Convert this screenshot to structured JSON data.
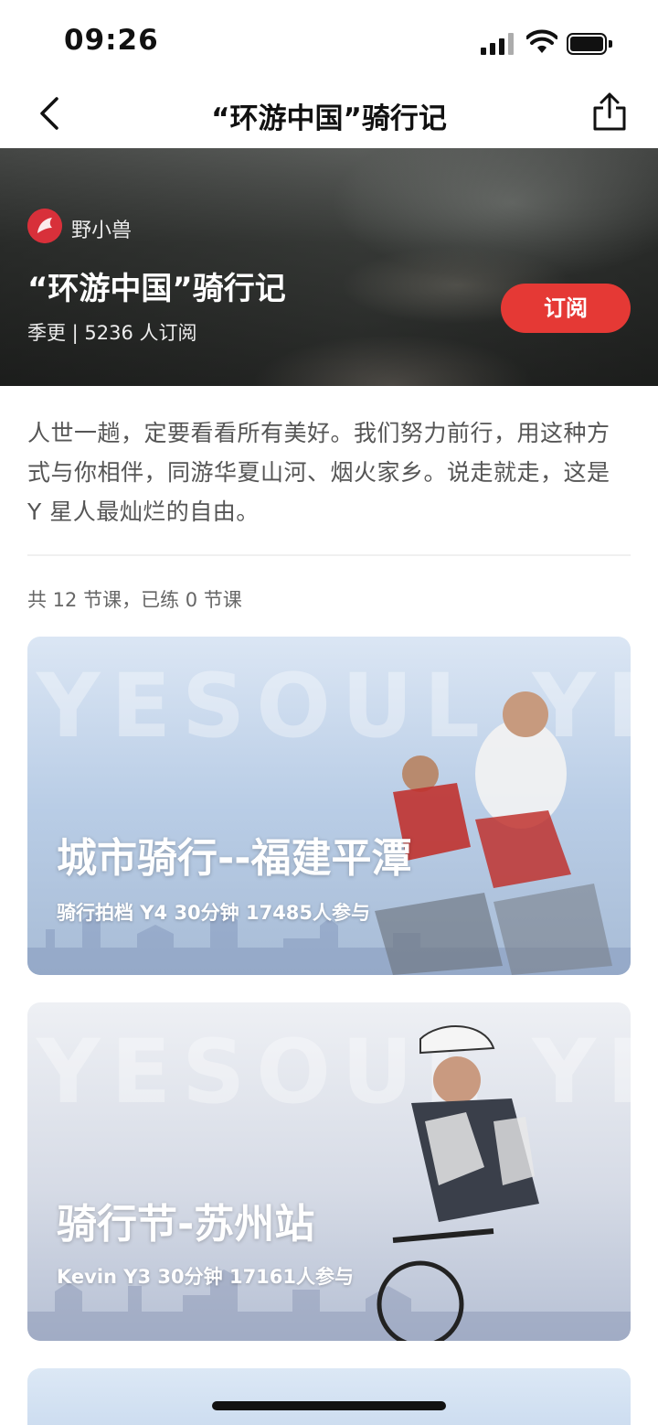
{
  "status_bar": {
    "time": "09:26"
  },
  "nav": {
    "title": "“环游中国”骑行记",
    "back_icon": "chevron-left-icon",
    "share_icon": "share-icon"
  },
  "hero": {
    "brand_name": "野小兽",
    "title": "“环游中国”骑行记",
    "meta": "季更 | 5236 人订阅",
    "subscribe_label": "订阅"
  },
  "description": "人世一趟，定要看看所有美好。我们努力前行，用这种方式与你相伴，同游华夏山河、烟火家乡。说走就走，这是 Y 星人最灿烂的自由。",
  "lesson_count": "共 12 节课，已练 0 节课",
  "courses": [
    {
      "title": "城市骑行--福建平潭",
      "meta": "骑行拍档  Y4  30分钟  17485人参与",
      "watermark": "YESOUL YESOUL"
    },
    {
      "title": "骑行节-苏州站",
      "meta": "Kevin  Y3  30分钟  17161人参与",
      "watermark": "YESOUL YESOUL"
    }
  ],
  "colors": {
    "accent": "#e53935",
    "brand_logo": "#d8303a"
  }
}
